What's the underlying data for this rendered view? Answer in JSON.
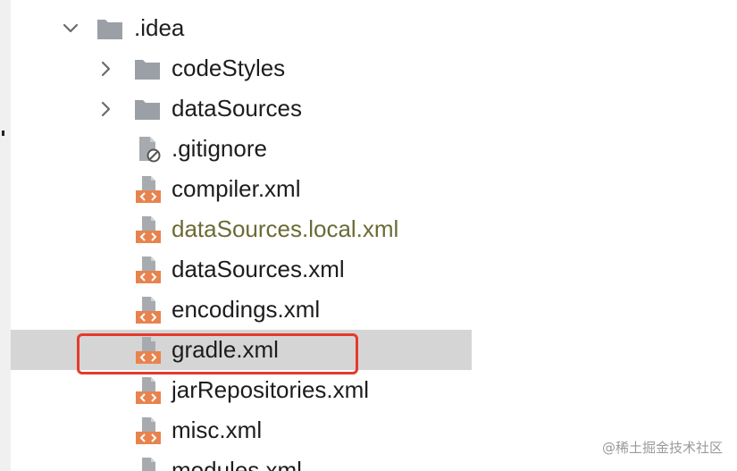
{
  "tree": {
    "root": {
      "label": ".idea",
      "icon": "folder-icon",
      "expanded": true
    },
    "folders": [
      {
        "label": "codeStyles",
        "icon": "folder-icon",
        "expanded": false
      },
      {
        "label": "dataSources",
        "icon": "folder-icon",
        "expanded": false
      }
    ],
    "files": [
      {
        "label": ".gitignore",
        "icon": "ignore-file-icon",
        "modified": false,
        "selected": false
      },
      {
        "label": "compiler.xml",
        "icon": "xml-file-icon",
        "modified": false,
        "selected": false
      },
      {
        "label": "dataSources.local.xml",
        "icon": "xml-file-icon",
        "modified": true,
        "selected": false
      },
      {
        "label": "dataSources.xml",
        "icon": "xml-file-icon",
        "modified": false,
        "selected": false
      },
      {
        "label": "encodings.xml",
        "icon": "xml-file-icon",
        "modified": false,
        "selected": false
      },
      {
        "label": "gradle.xml",
        "icon": "xml-file-icon",
        "modified": false,
        "selected": true
      },
      {
        "label": "jarRepositories.xml",
        "icon": "xml-file-icon",
        "modified": false,
        "selected": false
      },
      {
        "label": "misc.xml",
        "icon": "xml-file-icon",
        "modified": false,
        "selected": false
      },
      {
        "label": "modules.xml",
        "icon": "xml-file-icon",
        "modified": false,
        "selected": false
      }
    ]
  },
  "watermark": "@稀土掘金技术社区",
  "colors": {
    "selection_bg": "#d5d5d5",
    "highlight_border": "#e53a2d",
    "modified_text": "#6b6b36",
    "xml_icon_accent": "#e8834e",
    "folder_icon": "#9aa0a6"
  }
}
